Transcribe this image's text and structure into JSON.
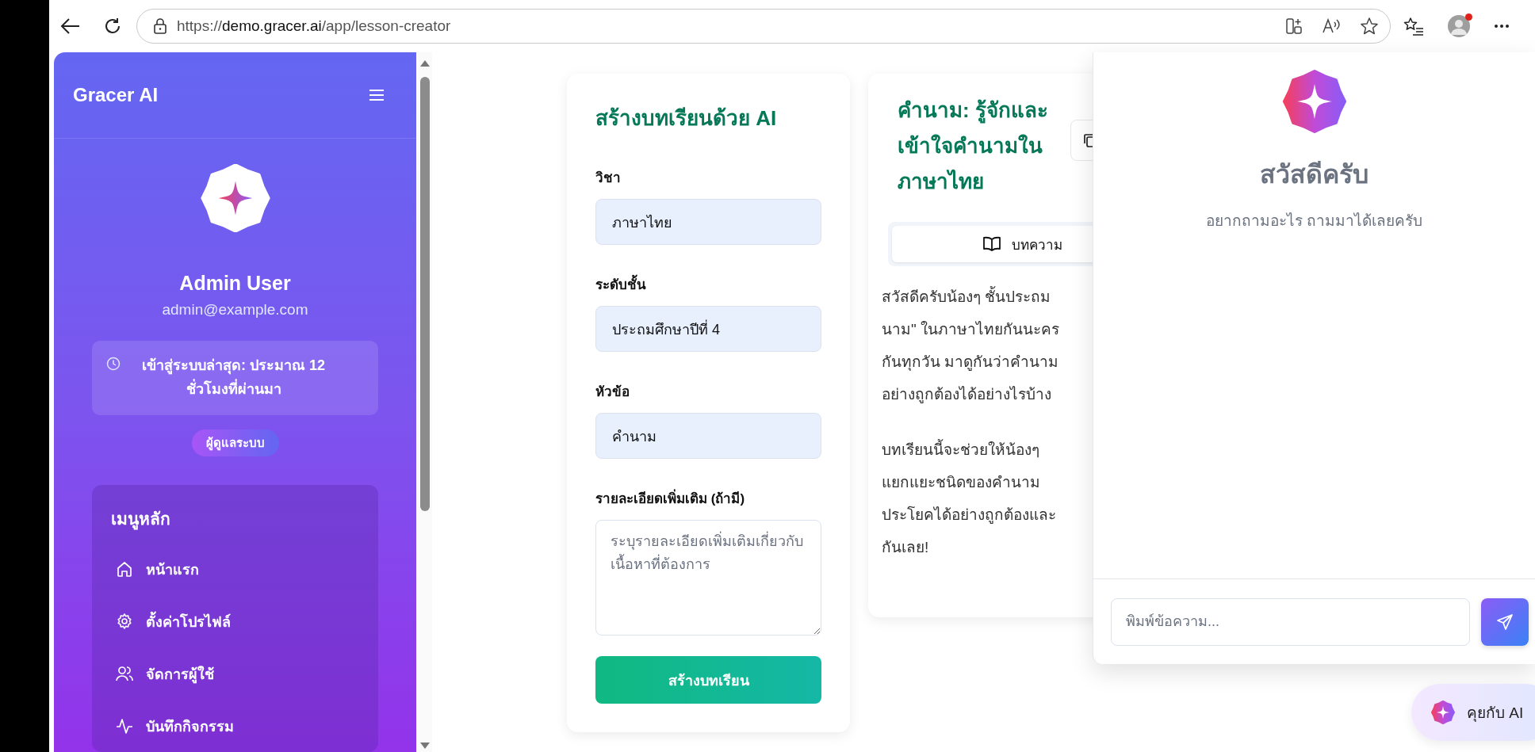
{
  "browser": {
    "url": {
      "scheme": "https://",
      "host": "demo.gracer.ai",
      "path": "/app/lesson-creator"
    }
  },
  "sidebar": {
    "brand": "Gracer AI",
    "user": {
      "name": "Admin User",
      "email": "admin@example.com"
    },
    "last_login": "เข้าสู่ระบบล่าสุด: ประมาณ 12 ชั่วโมงที่ผ่านมา",
    "role": "ผู้ดูแลระบบ",
    "menu_title": "เมนูหลัก",
    "menu": [
      {
        "label": "หน้าแรก"
      },
      {
        "label": "ตั้งค่าโปรไฟล์"
      },
      {
        "label": "จัดการผู้ใช้"
      },
      {
        "label": "บันทึกกิจกรรม"
      }
    ]
  },
  "lesson_form": {
    "title": "สร้างบทเรียนด้วย AI",
    "fields": [
      {
        "kind": "input",
        "label": "วิชา",
        "value": "ภาษาไทย"
      },
      {
        "kind": "input",
        "label": "ระดับชั้น",
        "value": "ประถมศึกษาปีที่ 4"
      },
      {
        "kind": "input",
        "label": "หัวข้อ",
        "value": "คำนาม"
      },
      {
        "kind": "textarea",
        "label": "รายละเอียดเพิ่มเติม (ถ้ามี)",
        "placeholder": "ระบุรายละเอียดเพิ่มเติมเกี่ยวกับเนื้อหาที่ต้องการ"
      }
    ],
    "submit": "สร้างบทเรียน"
  },
  "lesson": {
    "title": "คำนาม: รู้จักและเข้าใจคำนามใน ภาษาไทย",
    "tabs": [
      {
        "label": "บทความ",
        "selected": true
      }
    ],
    "paragraphs": [
      {
        "lines": [
          "สวัสดีครับน้องๆ ชั้นประถม",
          "นาม\" ในภาษาไทยกันนะคร",
          "กันทุกวัน มาดูกันว่าคำนาม",
          "อย่างถูกต้องได้อย่างไรบ้าง"
        ]
      },
      {
        "lines": [
          "บทเรียนนี้จะช่วยให้น้องๆ",
          "แยกแยะชนิดของคำนาม",
          "ประโยคได้อย่างถูกต้องและ",
          "กันเลย!"
        ]
      }
    ]
  },
  "chat": {
    "greeting": "สวัสดีครับ",
    "subtitle": "อยากถามอะไร ถามมาได้เลยครับ",
    "input": {
      "placeholder": "พิมพ์ข้อความ..."
    },
    "launcher": "คุยกับ AI"
  }
}
